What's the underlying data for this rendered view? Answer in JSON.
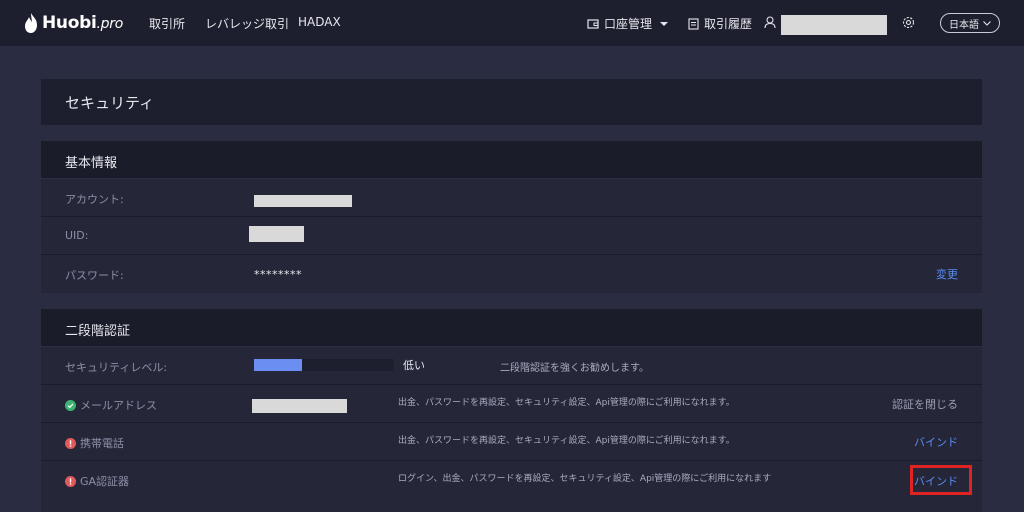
{
  "header": {
    "logo_main": "Huobi",
    "logo_suffix": ".pro",
    "nav": [
      {
        "label": "取引所"
      },
      {
        "label": "レバレッジ取引"
      },
      {
        "label": "HADAX"
      }
    ],
    "account_menu": "口座管理",
    "order_history": "取引履歴",
    "language": "日本語"
  },
  "security_panel": {
    "title": "セキュリティ"
  },
  "basic_info": {
    "title": "基本情報",
    "rows": [
      {
        "label": "アカウント:"
      },
      {
        "label": "UID:"
      },
      {
        "label": "パスワード:",
        "value": "********",
        "action": "変更"
      }
    ]
  },
  "two_factor": {
    "title": "二段階認証",
    "security_level": {
      "label": "セキュリティレベル:",
      "level_fraction": 0.34,
      "level_text": "低い",
      "hint": "二段階認証を強くお勧めします。"
    },
    "rows": [
      {
        "label": "メールアドレス",
        "status": "verified",
        "desc": "出金、パスワードを再設定、セキュリティ設定、Api管理の際にご利用になれます。",
        "action": "認証を閉じる"
      },
      {
        "label": "携帯電話",
        "status": "warning",
        "desc": "出金、パスワードを再設定、セキュリティ設定、Api管理の際にご利用になれます。",
        "action": "バインド"
      },
      {
        "label": "GA認証器",
        "status": "warning",
        "desc": "ログイン、出金、パスワードを再設定、セキュリティ設定、Api管理の際にご利用になれます",
        "action": "バインド"
      }
    ]
  },
  "colors": {
    "background": "#2a2c42",
    "panel": "#1e1f2e",
    "accent_link": "#5a8cf0",
    "level_fill": "#6b8ef2",
    "success": "#3cb371",
    "warning": "#e05a5a",
    "highlight": "#e02424"
  }
}
